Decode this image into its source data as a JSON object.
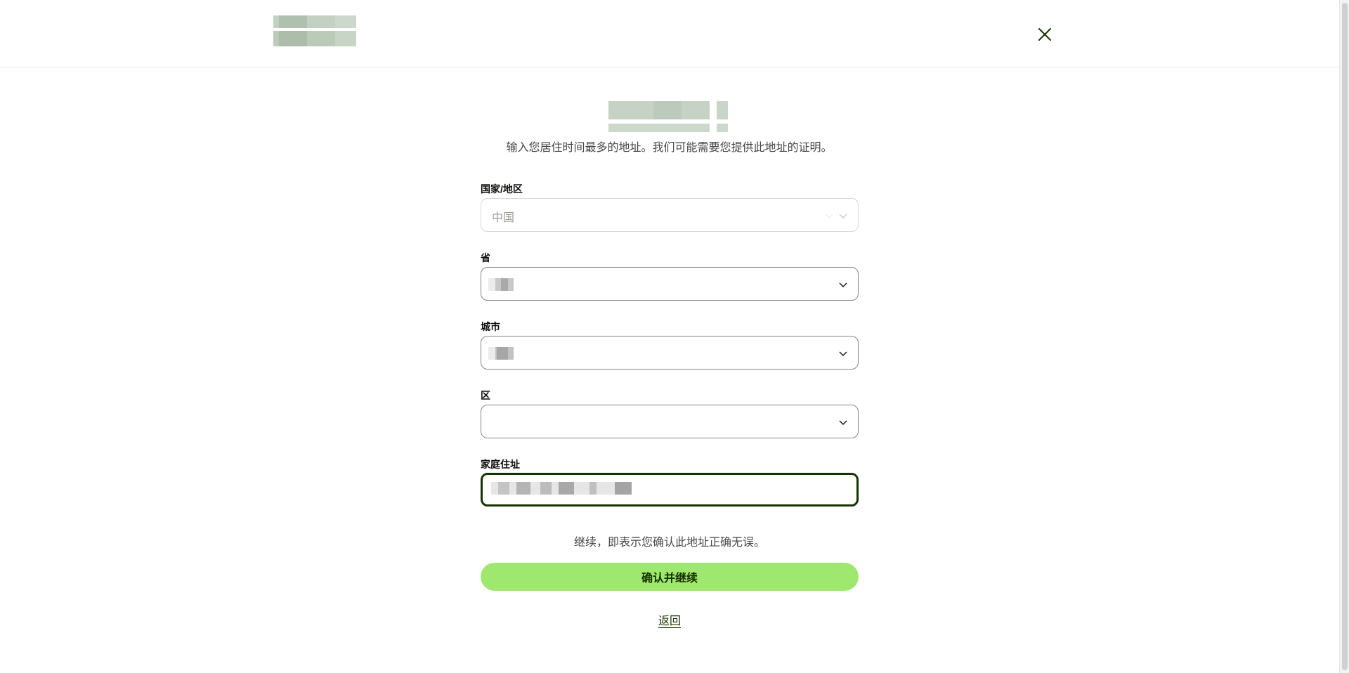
{
  "header": {
    "close_icon": "close-icon"
  },
  "form": {
    "subtitle": "输入您居住时间最多的地址。我们可能需要您提供此地址的证明。",
    "country": {
      "label": "国家/地区",
      "value": "中国"
    },
    "province": {
      "label": "省",
      "value": ""
    },
    "city": {
      "label": "城市",
      "value": ""
    },
    "district": {
      "label": "区",
      "value": ""
    },
    "home_address": {
      "label": "家庭住址",
      "value": ""
    },
    "notice": "继续，即表示您确认此地址正确无误。",
    "confirm_label": "确认并继续",
    "back_label": "返回"
  },
  "colors": {
    "accent_green": "#9fe870",
    "forest_green": "#163300"
  }
}
